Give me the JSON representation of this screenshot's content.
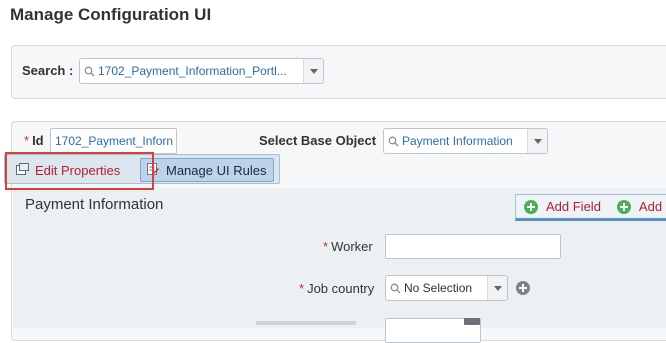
{
  "page": {
    "title": "Manage Configuration UI"
  },
  "search": {
    "label": "Search :",
    "value": "1702_Payment_Information_Portl..."
  },
  "form": {
    "id_label": "Id",
    "id_required_marker": "*",
    "id_value": "1702_Payment_Inforn",
    "base_object_label": "Select Base Object",
    "base_object_value": "Payment Information"
  },
  "tabs": [
    {
      "label": "Edit Properties",
      "icon": "edit-properties-icon",
      "active": false,
      "highlighted": true
    },
    {
      "label": "Manage UI Rules",
      "icon": "rules-icon",
      "active": true
    }
  ],
  "section": {
    "title": "Payment Information",
    "toolbar": [
      {
        "label": "Add Field",
        "icon": "add-green-icon"
      },
      {
        "label": "Add",
        "icon": "add-green-icon"
      }
    ],
    "fields": [
      {
        "label": "Worker",
        "required": true,
        "value": ""
      },
      {
        "label": "Job country",
        "required": true,
        "value": "No Selection"
      }
    ]
  },
  "colors": {
    "required": "#cc2b2b",
    "link_red": "#b3202b",
    "value_blue": "#2b6cae",
    "highlight": "#d8413b",
    "add_green": "#4caf50"
  }
}
